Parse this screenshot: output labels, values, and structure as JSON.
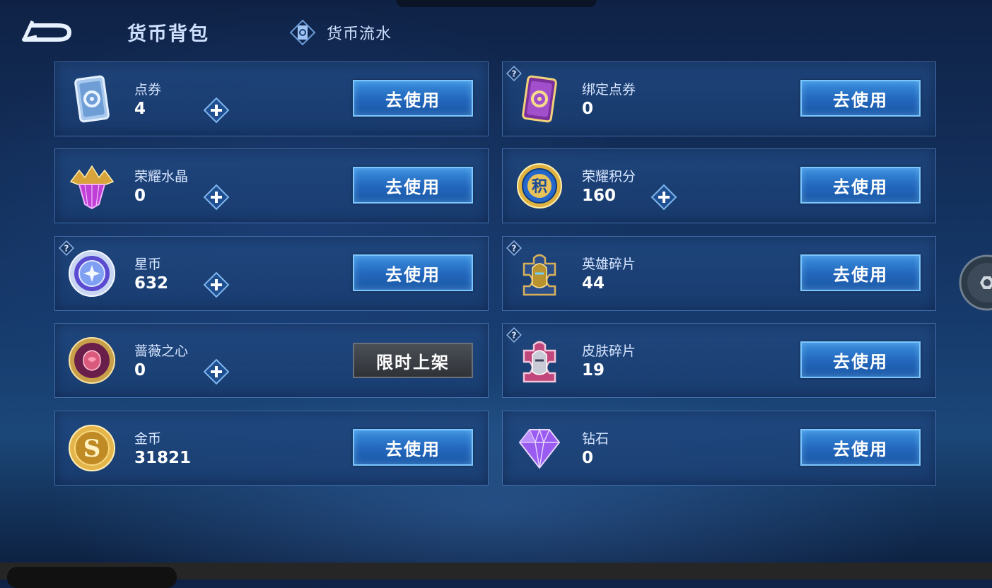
{
  "header": {
    "title": "货币背包",
    "flow_label": "货币流水"
  },
  "currencies": [
    {
      "name": "点券",
      "value": "4",
      "action": "去使用",
      "icon": "coupon-card-icon",
      "has_plus": true
    },
    {
      "name": "绑定点券",
      "value": "0",
      "action": "去使用",
      "icon": "bound-coupon-card-icon",
      "has_help": true
    },
    {
      "name": "荣耀水晶",
      "value": "0",
      "action": "去使用",
      "icon": "glory-crystal-icon",
      "has_plus": true
    },
    {
      "name": "荣耀积分",
      "value": "160",
      "action": "去使用",
      "icon": "glory-points-icon",
      "has_plus": true
    },
    {
      "name": "星币",
      "value": "632",
      "action": "去使用",
      "icon": "star-coin-icon",
      "has_plus": true,
      "has_help": true
    },
    {
      "name": "英雄碎片",
      "value": "44",
      "action": "去使用",
      "icon": "hero-shard-icon",
      "has_help": true
    },
    {
      "name": "蔷薇之心",
      "value": "0",
      "action": "限时上架",
      "icon": "rose-heart-icon",
      "has_plus": true
    },
    {
      "name": "皮肤碎片",
      "value": "19",
      "action": "去使用",
      "icon": "skin-shard-icon",
      "has_help": true
    },
    {
      "name": "金币",
      "value": "31821",
      "action": "去使用",
      "icon": "gold-coin-icon"
    },
    {
      "name": "钻石",
      "value": "0",
      "action": "去使用",
      "icon": "diamond-icon"
    }
  ],
  "colors": {
    "button_fill": "#2a72c4",
    "button_border": "#7cc6ff",
    "disabled_button": "#3b4046",
    "panel_fill": "#1e4680"
  }
}
